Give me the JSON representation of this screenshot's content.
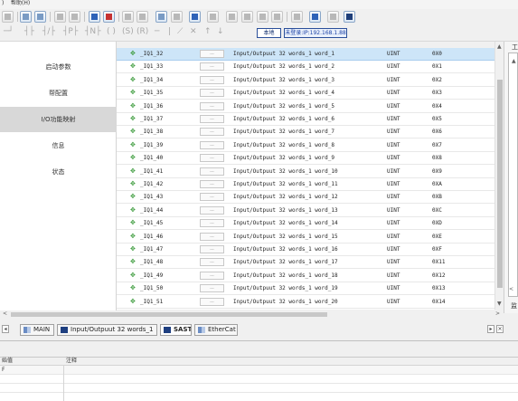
{
  "menubar": {
    "item_left": ")",
    "item_help": "帮助(H)"
  },
  "toolbar": {
    "local_btn": "本地",
    "login_btn": "未登录:IP:192.168.1.88"
  },
  "nav": {
    "items": [
      {
        "label": "启动参数"
      },
      {
        "label": "帮配置"
      },
      {
        "label": "I/O功能映射",
        "active": true
      },
      {
        "label": "信息"
      },
      {
        "label": "状态"
      }
    ]
  },
  "table": {
    "button_label": "...",
    "rows": [
      {
        "name": "_IQ1_32",
        "desc": "Input/Outpuut 32 words_1 word_1",
        "type": "UINT",
        "addr": "0X0",
        "selected": true
      },
      {
        "name": "_IQ1_33",
        "desc": "Input/Outpuut 32 words_1 word_2",
        "type": "UINT",
        "addr": "0X1"
      },
      {
        "name": "_IQ1_34",
        "desc": "Input/Outpuut 32 words_1 word_3",
        "type": "UINT",
        "addr": "0X2"
      },
      {
        "name": "_IQ1_35",
        "desc": "Input/Outpuut 32 words_1 word_4",
        "type": "UINT",
        "addr": "0X3"
      },
      {
        "name": "_IQ1_36",
        "desc": "Input/Outpuut 32 words_1 word_5",
        "type": "UINT",
        "addr": "0X4"
      },
      {
        "name": "_IQ1_37",
        "desc": "Input/Outpuut 32 words_1 word_6",
        "type": "UINT",
        "addr": "0X5"
      },
      {
        "name": "_IQ1_38",
        "desc": "Input/Outpuut 32 words_1 word_7",
        "type": "UINT",
        "addr": "0X6"
      },
      {
        "name": "_IQ1_39",
        "desc": "Input/Outpuut 32 words_1 word_8",
        "type": "UINT",
        "addr": "0X7"
      },
      {
        "name": "_IQ1_40",
        "desc": "Input/Outpuut 32 words_1 word_9",
        "type": "UINT",
        "addr": "0X8"
      },
      {
        "name": "_IQ1_41",
        "desc": "Input/Outpuut 32 words_1 word_10",
        "type": "UINT",
        "addr": "0X9"
      },
      {
        "name": "_IQ1_42",
        "desc": "Input/Outpuut 32 words_1 word_11",
        "type": "UINT",
        "addr": "0XA"
      },
      {
        "name": "_IQ1_43",
        "desc": "Input/Outpuut 32 words_1 word_12",
        "type": "UINT",
        "addr": "0XB"
      },
      {
        "name": "_IQ1_44",
        "desc": "Input/Outpuut 32 words_1 word_13",
        "type": "UINT",
        "addr": "0XC"
      },
      {
        "name": "_IQ1_45",
        "desc": "Input/Outpuut 32 words_1 word_14",
        "type": "UINT",
        "addr": "0XD"
      },
      {
        "name": "_IQ1_46",
        "desc": "Input/Outpuut 32 words_1 word_15",
        "type": "UINT",
        "addr": "0XE"
      },
      {
        "name": "_IQ1_47",
        "desc": "Input/Outpuut 32 words_1 word_16",
        "type": "UINT",
        "addr": "0XF"
      },
      {
        "name": "_IQ1_48",
        "desc": "Input/Outpuut 32 words_1 word_17",
        "type": "UINT",
        "addr": "0X11"
      },
      {
        "name": "_IQ1_49",
        "desc": "Input/Outpuut 32 words_1 word_18",
        "type": "UINT",
        "addr": "0X12"
      },
      {
        "name": "_IQ1_50",
        "desc": "Input/Outpuut 32 words_1 word_19",
        "type": "UINT",
        "addr": "0X13"
      },
      {
        "name": "_IQ1_51",
        "desc": "Input/Outpuut 32 words_1 word_20",
        "type": "UINT",
        "addr": "0X14"
      }
    ]
  },
  "tabs": {
    "items": [
      {
        "label": "MAIN"
      },
      {
        "label": "Input/Outpuut 32 words_1"
      },
      {
        "label": "SAST",
        "active": true
      },
      {
        "label": "EtherCat"
      }
    ]
  },
  "right_panel": {
    "top_label": "工",
    "side_label": "监"
  },
  "bottom": {
    "col1_header": "始值",
    "col2_header": "注释",
    "row1_value": "F"
  },
  "colors": {
    "selection": "#cde5f8",
    "accent": "#2b4f9a",
    "variable_icon": "#3a9a3a"
  }
}
